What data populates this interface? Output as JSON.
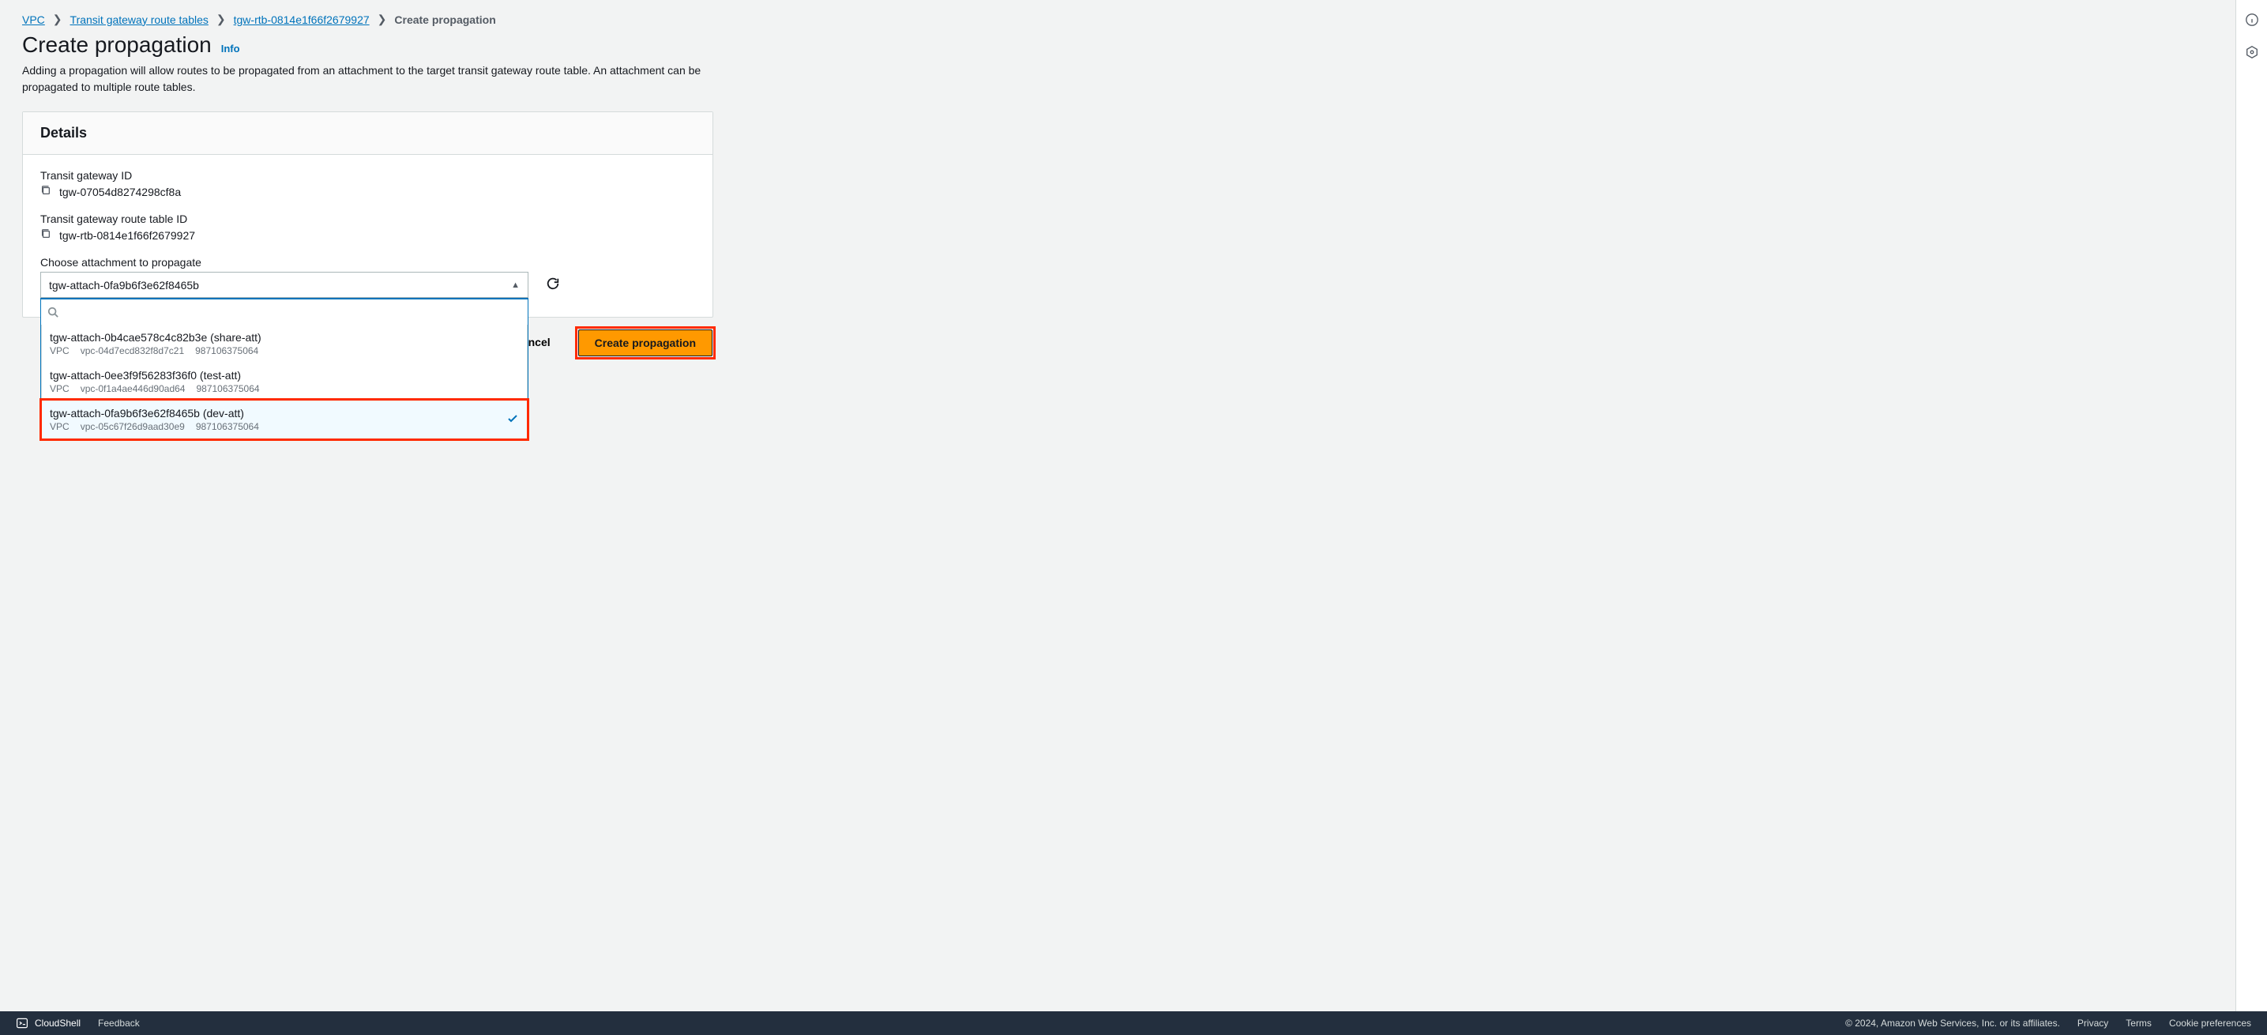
{
  "breadcrumbs": {
    "items": [
      "VPC",
      "Transit gateway route tables",
      "tgw-rtb-0814e1f66f2679927"
    ],
    "current": "Create propagation"
  },
  "page": {
    "title": "Create propagation",
    "info": "Info",
    "description": "Adding a propagation will allow routes to be propagated from an attachment to the target transit gateway route table. An attachment can be propagated to multiple route tables."
  },
  "details": {
    "panel_title": "Details",
    "tgw_id_label": "Transit gateway ID",
    "tgw_id": "tgw-07054d8274298cf8a",
    "rtb_id_label": "Transit gateway route table ID",
    "rtb_id": "tgw-rtb-0814e1f66f2679927",
    "attach_label": "Choose attachment to propagate",
    "selected": "tgw-attach-0fa9b6f3e62f8465b",
    "options": [
      {
        "id": "tgw-attach-0b4cae578c4c82b3e",
        "name": "share-att",
        "type": "VPC",
        "res": "vpc-04d7ecd832f8d7c21",
        "acct": "987106375064",
        "selected": false
      },
      {
        "id": "tgw-attach-0ee3f9f56283f36f0",
        "name": "test-att",
        "type": "VPC",
        "res": "vpc-0f1a4ae446d90ad64",
        "acct": "987106375064",
        "selected": false
      },
      {
        "id": "tgw-attach-0fa9b6f3e62f8465b",
        "name": "dev-att",
        "type": "VPC",
        "res": "vpc-05c67f26d9aad30e9",
        "acct": "987106375064",
        "selected": true
      }
    ]
  },
  "actions": {
    "cancel": "Cancel",
    "submit": "Create propagation"
  },
  "footer": {
    "cloudshell": "CloudShell",
    "feedback": "Feedback",
    "copyright": "© 2024, Amazon Web Services, Inc. or its affiliates.",
    "privacy": "Privacy",
    "terms": "Terms",
    "cookie": "Cookie preferences"
  }
}
